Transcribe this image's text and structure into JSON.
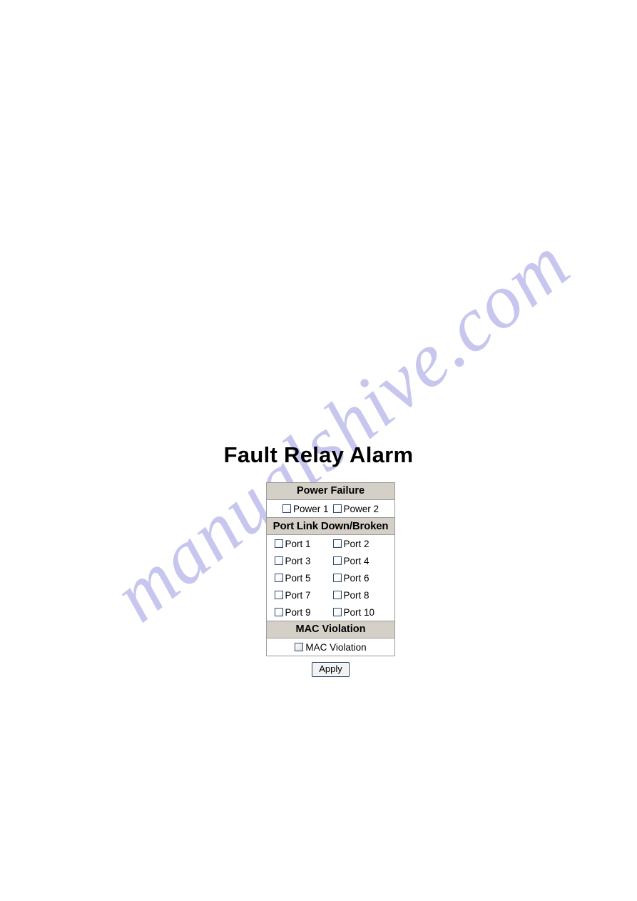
{
  "watermark": {
    "text": "manualshive.com",
    "color": "#c7c6ee"
  },
  "page": {
    "title": "Fault Relay Alarm",
    "background": "#ffffff"
  },
  "form": {
    "header_background": "#d4d0c8",
    "border_color": "#9a9a9a",
    "checkbox_border_color": "#2b4a6b",
    "sections": [
      {
        "header": "Power Failure",
        "rows": [
          [
            {
              "label": "Power 1",
              "checked": false
            },
            {
              "label": "Power 2",
              "checked": false
            }
          ]
        ]
      },
      {
        "header": "Port Link Down/Broken",
        "rows": [
          [
            {
              "label": "Port 1",
              "checked": false
            },
            {
              "label": "Port 2",
              "checked": false
            }
          ],
          [
            {
              "label": "Port 3",
              "checked": false
            },
            {
              "label": "Port 4",
              "checked": false
            }
          ],
          [
            {
              "label": "Port 5",
              "checked": false
            },
            {
              "label": "Port 6",
              "checked": false
            }
          ],
          [
            {
              "label": "Port 7",
              "checked": false
            },
            {
              "label": "Port 8",
              "checked": false
            }
          ],
          [
            {
              "label": "Port 9",
              "checked": false
            },
            {
              "label": "Port 10",
              "checked": false
            }
          ]
        ]
      },
      {
        "header": "MAC Violation",
        "rows": [
          [
            {
              "label": "MAC Violation",
              "checked": false
            }
          ]
        ]
      }
    ]
  },
  "actions": {
    "apply_label": "Apply"
  }
}
